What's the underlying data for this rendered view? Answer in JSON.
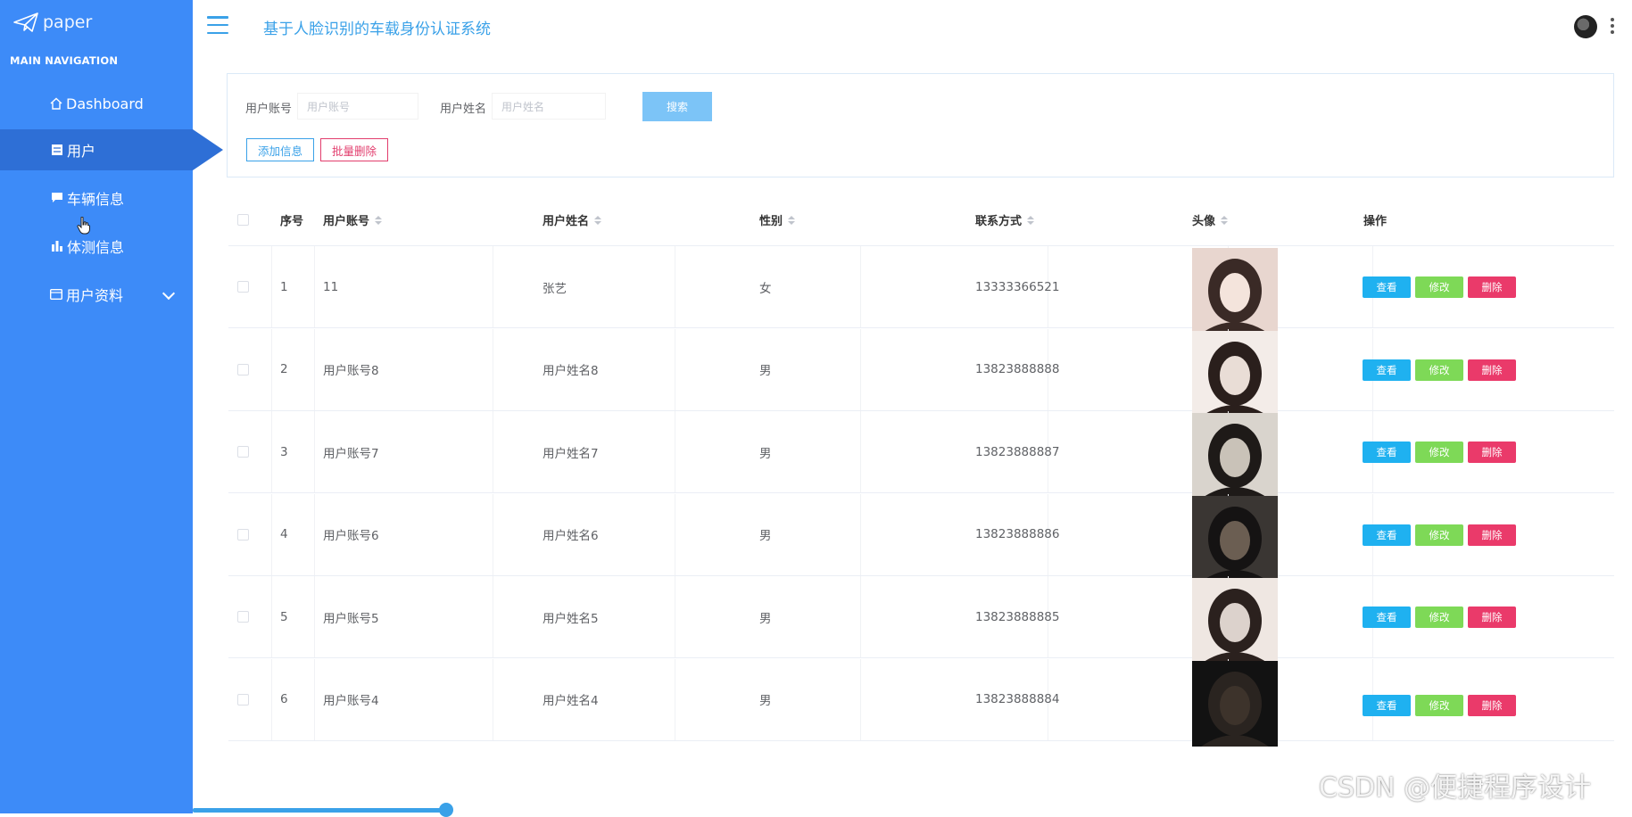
{
  "sidebar": {
    "logo_text": "paper",
    "section_title": "MAIN NAVIGATION",
    "items": [
      {
        "label": "Dashboard",
        "icon": "home-icon"
      },
      {
        "label": "用户",
        "icon": "list-icon",
        "active": true
      },
      {
        "label": "车辆信息",
        "icon": "message-icon"
      },
      {
        "label": "体测信息",
        "icon": "bar-chart-icon"
      },
      {
        "label": "用户资料",
        "icon": "card-icon",
        "expandable": true
      }
    ]
  },
  "header": {
    "title": "基于人脸识别的车载身份认证系统",
    "menu_icon": "hamburger-icon",
    "avatar_icon": "user-avatar",
    "more_icon": "kebab-icon"
  },
  "search": {
    "account_label": "用户账号",
    "account_placeholder": "用户账号",
    "name_label": "用户姓名",
    "name_placeholder": "用户姓名",
    "search_button": "搜索",
    "add_button": "添加信息",
    "batch_delete_button": "批量删除"
  },
  "table": {
    "headers": [
      "序号",
      "用户账号",
      "用户姓名",
      "性别",
      "联系方式",
      "头像",
      "操作"
    ],
    "actions": {
      "view": "查看",
      "edit": "修改",
      "delete": "删除"
    },
    "rows": [
      {
        "index": "1",
        "account": "11",
        "name": "张艺",
        "gender": "女",
        "phone": "13333366521"
      },
      {
        "index": "2",
        "account": "用户账号8",
        "name": "用户姓名8",
        "gender": "男",
        "phone": "13823888888"
      },
      {
        "index": "3",
        "account": "用户账号7",
        "name": "用户姓名7",
        "gender": "男",
        "phone": "13823888887"
      },
      {
        "index": "4",
        "account": "用户账号6",
        "name": "用户姓名6",
        "gender": "男",
        "phone": "13823888886"
      },
      {
        "index": "5",
        "account": "用户账号5",
        "name": "用户姓名5",
        "gender": "男",
        "phone": "13823888885"
      },
      {
        "index": "6",
        "account": "用户账号4",
        "name": "用户姓名4",
        "gender": "男",
        "phone": "13823888884"
      }
    ]
  },
  "colors": {
    "sidebar": "#3d8bf8",
    "sidebar_active": "#2e6fd6",
    "accent": "#3aa1e8",
    "view": "#1fb1f0",
    "edit": "#7ed957",
    "delete": "#ea3a6a"
  },
  "watermark": "CSDN @便捷程序设计"
}
